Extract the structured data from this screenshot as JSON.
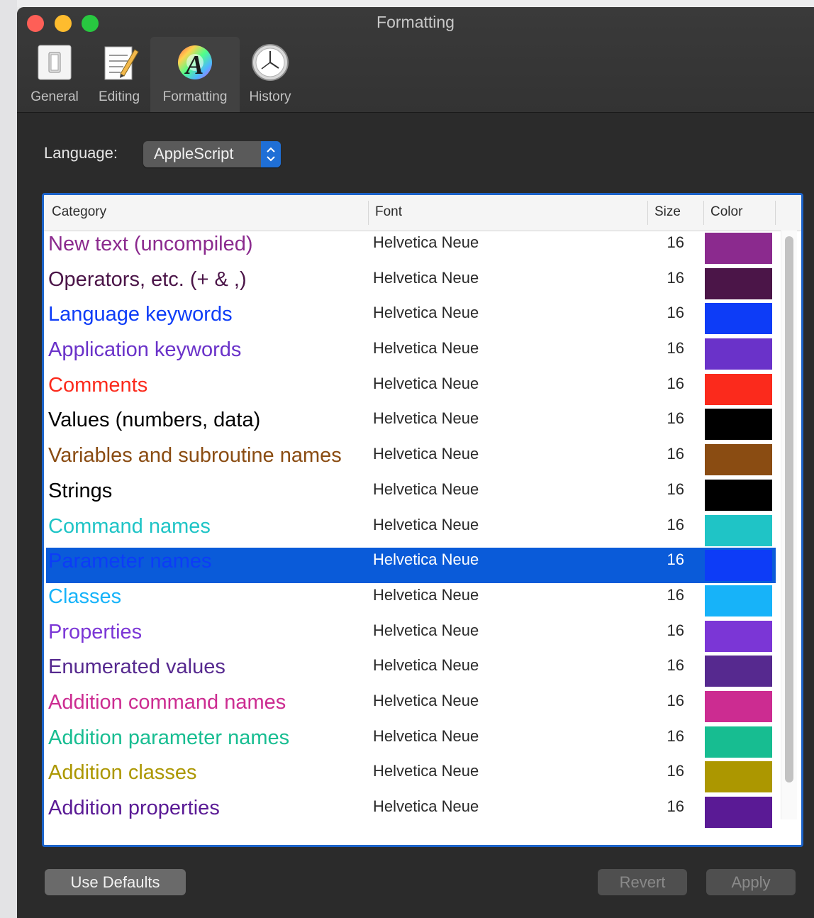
{
  "window": {
    "title": "Formatting"
  },
  "toolbar": {
    "items": [
      {
        "label": "General",
        "icon": "light-switch-icon"
      },
      {
        "label": "Editing",
        "icon": "notepad-pencil-icon"
      },
      {
        "label": "Formatting",
        "icon": "color-font-icon",
        "selected": true
      },
      {
        "label": "History",
        "icon": "clock-icon"
      }
    ]
  },
  "language": {
    "label": "Language:",
    "value": "AppleScript"
  },
  "table": {
    "headers": {
      "category": "Category",
      "font": "Font",
      "size": "Size",
      "color": "Color"
    },
    "rows": [
      {
        "category": "New text (uncompiled)",
        "font": "Helvetica Neue",
        "size": "16",
        "color": "#8b2a8e"
      },
      {
        "category": "Operators, etc. (+ & ,)",
        "font": "Helvetica Neue",
        "size": "16",
        "color": "#4b1548"
      },
      {
        "category": "Language keywords",
        "font": "Helvetica Neue",
        "size": "16",
        "color": "#0d3cf7"
      },
      {
        "category": "Application keywords",
        "font": "Helvetica Neue",
        "size": "16",
        "color": "#6a32c9"
      },
      {
        "category": "Comments",
        "font": "Helvetica Neue",
        "size": "16",
        "color": "#fb2a1c"
      },
      {
        "category": "Values (numbers, data)",
        "font": "Helvetica Neue",
        "size": "16",
        "color": "#000000"
      },
      {
        "category": "Variables and subroutine names",
        "font": "Helvetica Neue",
        "size": "16",
        "color": "#8a4c12"
      },
      {
        "category": "Strings",
        "font": "Helvetica Neue",
        "size": "16",
        "color": "#000000"
      },
      {
        "category": "Command names",
        "font": "Helvetica Neue",
        "size": "16",
        "color": "#1fc4c6"
      },
      {
        "category": "Parameter names",
        "font": "Helvetica Neue",
        "size": "16",
        "color": "#0d3cf7",
        "selected": true
      },
      {
        "category": "Classes",
        "font": "Helvetica Neue",
        "size": "16",
        "color": "#17b3f9"
      },
      {
        "category": "Properties",
        "font": "Helvetica Neue",
        "size": "16",
        "color": "#7b36d6"
      },
      {
        "category": "Enumerated values",
        "font": "Helvetica Neue",
        "size": "16",
        "color": "#56298f"
      },
      {
        "category": "Addition command names",
        "font": "Helvetica Neue",
        "size": "16",
        "color": "#cc2c91"
      },
      {
        "category": "Addition parameter names",
        "font": "Helvetica Neue",
        "size": "16",
        "color": "#17bd91"
      },
      {
        "category": "Addition classes",
        "font": "Helvetica Neue",
        "size": "16",
        "color": "#ac9700"
      },
      {
        "category": "Addition properties",
        "font": "Helvetica Neue",
        "size": "16",
        "color": "#5a1a95"
      }
    ]
  },
  "buttons": {
    "use_defaults": "Use Defaults",
    "revert": "Revert",
    "apply": "Apply"
  }
}
